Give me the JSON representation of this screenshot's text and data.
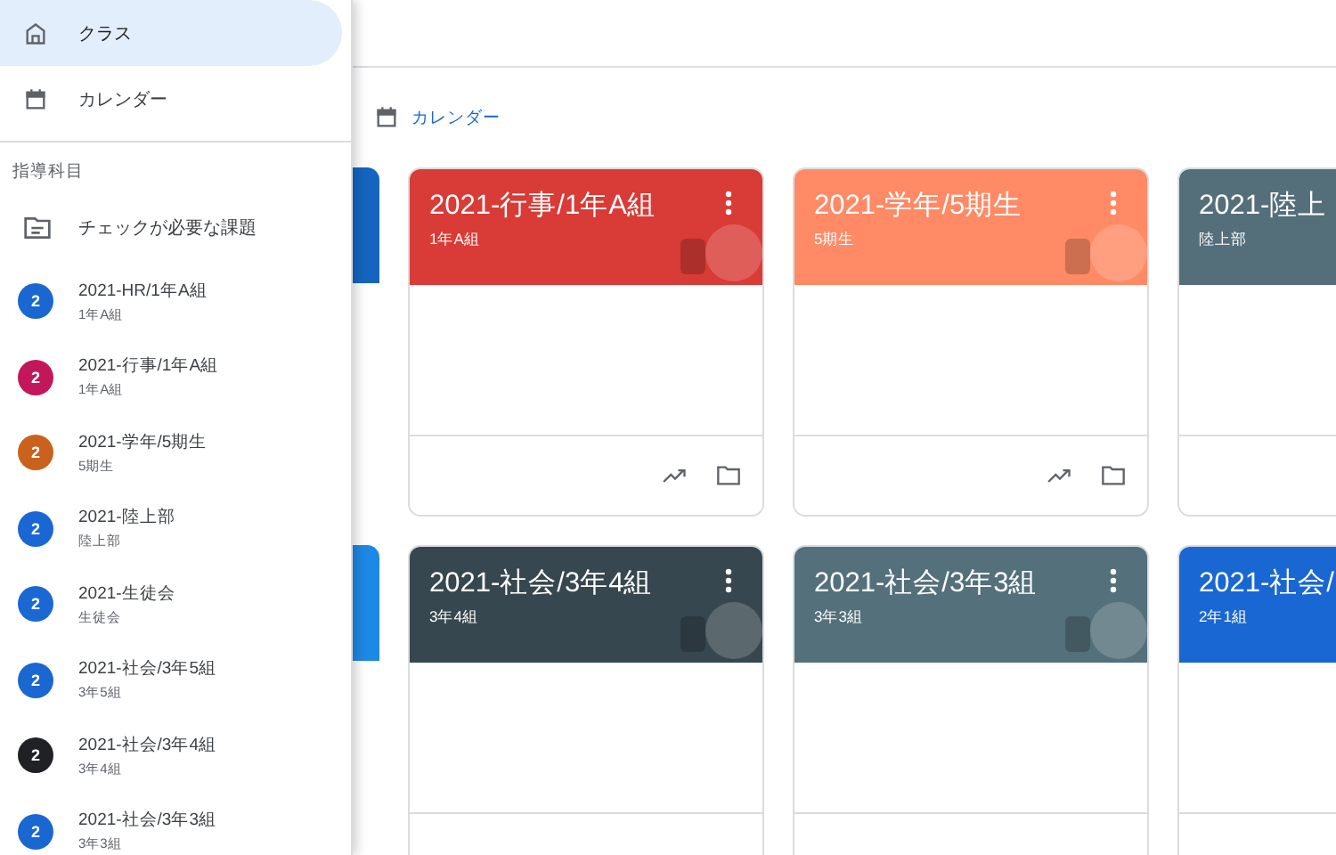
{
  "drawer": {
    "nav": [
      {
        "label": "クラス",
        "selected": true
      },
      {
        "label": "カレンダー",
        "selected": false
      }
    ],
    "section_title": "指導科目",
    "review": {
      "label": "チェックが必要な課題"
    },
    "classes": [
      {
        "name": "2021-HR/1年A組",
        "section": "1年A組",
        "initial": "2",
        "color": "#1a67d2"
      },
      {
        "name": "2021-行事/1年A組",
        "section": "1年A組",
        "initial": "2",
        "color": "#c2185b"
      },
      {
        "name": "2021-学年/5期生",
        "section": "5期生",
        "initial": "2",
        "color": "#c8621c"
      },
      {
        "name": "2021-陸上部",
        "section": "陸上部",
        "initial": "2",
        "color": "#1a67d3"
      },
      {
        "name": "2021-生徒会",
        "section": "生徒会",
        "initial": "2",
        "color": "#1a68d2"
      },
      {
        "name": "2021-社会/3年5組",
        "section": "3年5組",
        "initial": "2",
        "color": "#1b67d2"
      },
      {
        "name": "2021-社会/3年4組",
        "section": "3年4組",
        "initial": "2",
        "color": "#202124"
      },
      {
        "name": "2021-社会/3年3組",
        "section": "3年3組",
        "initial": "2",
        "color": "#1967d1"
      }
    ]
  },
  "calendar_link": {
    "label": "カレンダー"
  },
  "cards": [
    {
      "kind": "covered",
      "color": "#1565c0"
    },
    {
      "kind": "class",
      "title": "2021-行事/1年A組",
      "section": "1年A組",
      "color": "#d93b36",
      "menu": true,
      "actions": true
    },
    {
      "kind": "class",
      "title": "2021-学年/5期生",
      "section": "5期生",
      "color": "#ff8a65",
      "menu": true,
      "actions": true
    },
    {
      "kind": "class",
      "title": "2021-陸上",
      "section": "陸上部",
      "color": "#546e7a"
    },
    {
      "kind": "covered",
      "color": "#1e88e5"
    },
    {
      "kind": "class",
      "title": "2021-社会/3年4組",
      "section": "3年4組",
      "color": "#37474f",
      "menu": true,
      "actions": false
    },
    {
      "kind": "class",
      "title": "2021-社会/3年3組",
      "section": "3年3組",
      "color": "#53707b",
      "menu": true,
      "actions": false
    },
    {
      "kind": "class",
      "title": "2021-社会/",
      "section": "2年1組",
      "color": "#1967d2"
    }
  ]
}
